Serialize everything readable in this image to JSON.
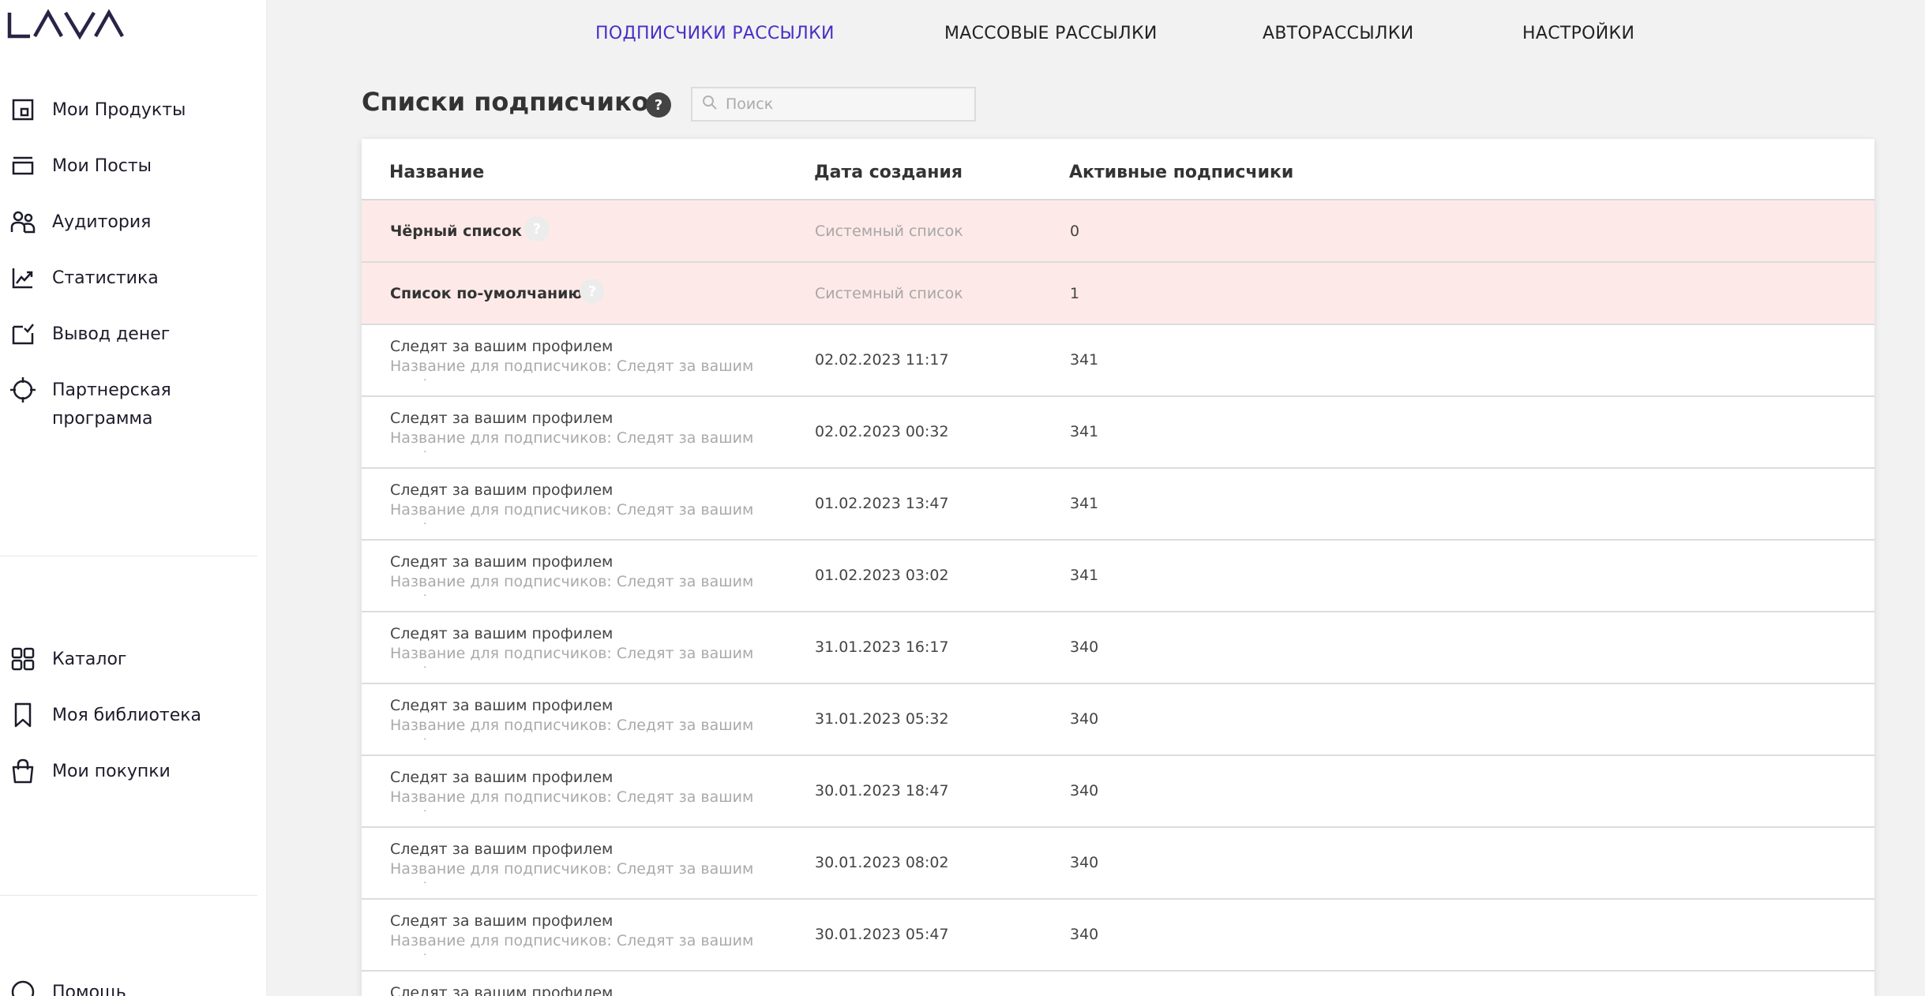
{
  "brand": {
    "logo_text": "LAVA"
  },
  "sidebar": {
    "items": [
      {
        "label": "Мои Продукты",
        "icon": "products-icon"
      },
      {
        "label": "Мои Посты",
        "icon": "posts-icon"
      },
      {
        "label": "Аудитория",
        "icon": "audience-icon"
      },
      {
        "label": "Статистика",
        "icon": "statistics-icon"
      },
      {
        "label": "Вывод денег",
        "icon": "withdraw-icon"
      },
      {
        "label": "Партнерская",
        "label2": "программа",
        "icon": "partner-icon"
      }
    ],
    "items2": [
      {
        "label": "Каталог",
        "icon": "catalog-icon"
      },
      {
        "label": "Моя библиотека",
        "icon": "bookmark-icon"
      },
      {
        "label": "Мои покупки",
        "icon": "bag-icon"
      }
    ],
    "help_partial": "Помощь"
  },
  "topnav": {
    "tabs": [
      {
        "label": "ПОДПИСЧИКИ РАССЫЛКИ",
        "active": true
      },
      {
        "label": "МАССОВЫЕ РАССЫЛКИ",
        "active": false
      },
      {
        "label": "АВТОРАССЫЛКИ",
        "active": false
      },
      {
        "label": "НАСТРОЙКИ",
        "active": false
      }
    ]
  },
  "header": {
    "title": "Списки подписчиков",
    "help": "?",
    "search_placeholder": "Поиск"
  },
  "table": {
    "columns": [
      "Название",
      "Дата создания",
      "Активные подписчики"
    ],
    "system_rows": [
      {
        "name": "Чёрный список",
        "date": "Системный список",
        "count": "0"
      },
      {
        "name": "Список по-умолчанию",
        "date": "Системный список",
        "count": "1"
      }
    ],
    "rows": [
      {
        "title": "Следят за вашим профилем",
        "subtitle": "Название для подписчиков: Следят за вашим профилем",
        "date": "02.02.2023 11:17",
        "count": "341"
      },
      {
        "title": "Следят за вашим профилем",
        "subtitle": "Название для подписчиков: Следят за вашим профилем",
        "date": "02.02.2023 00:32",
        "count": "341"
      },
      {
        "title": "Следят за вашим профилем",
        "subtitle": "Название для подписчиков: Следят за вашим профилем",
        "date": "01.02.2023 13:47",
        "count": "341"
      },
      {
        "title": "Следят за вашим профилем",
        "subtitle": "Название для подписчиков: Следят за вашим профилем",
        "date": "01.02.2023 03:02",
        "count": "341"
      },
      {
        "title": "Следят за вашим профилем",
        "subtitle": "Название для подписчиков: Следят за вашим профилем",
        "date": "31.01.2023 16:17",
        "count": "340"
      },
      {
        "title": "Следят за вашим профилем",
        "subtitle": "Название для подписчиков: Следят за вашим профилем",
        "date": "31.01.2023 05:32",
        "count": "340"
      },
      {
        "title": "Следят за вашим профилем",
        "subtitle": "Название для подписчиков: Следят за вашим профилем",
        "date": "30.01.2023 18:47",
        "count": "340"
      },
      {
        "title": "Следят за вашим профилем",
        "subtitle": "Название для подписчиков: Следят за вашим профилем",
        "date": "30.01.2023 08:02",
        "count": "340"
      },
      {
        "title": "Следят за вашим профилем",
        "subtitle": "Название для подписчиков: Следят за вашим профилем",
        "date": "30.01.2023 05:47",
        "count": "340"
      },
      {
        "title": "Следят за вашим профилем",
        "subtitle": "",
        "date": "",
        "count": ""
      }
    ]
  },
  "colors": {
    "accent": "#4a2ec7",
    "system_row_bg": "#fdeae8",
    "page_bg": "#f2f2f2"
  }
}
